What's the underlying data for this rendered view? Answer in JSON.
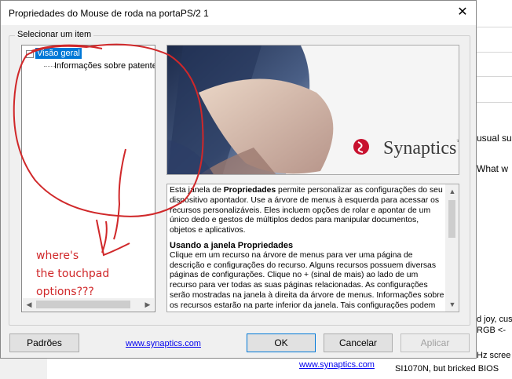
{
  "dialog": {
    "title": "Propriedades do Mouse de roda na portaPS/2  1",
    "close_glyph": "✕",
    "group_label": "Selecionar um item"
  },
  "tree": {
    "expander_glyph": "−",
    "root": "Visão geral",
    "child": "Informações sobre patentes"
  },
  "logo": {
    "text": "Synaptics",
    "tm": "™",
    "accent_color": "#c8102e"
  },
  "description": {
    "p1_pre": "Esta janela de ",
    "p1_bold": "Propriedades",
    "p1_post": " permite personalizar as configurações do seu dispositivo apontador. Use a árvore de menus à esquerda para acessar os recursos personalizáveis. Eles incluem opções de rolar e apontar de um único dedo e gestos de múltiplos dedos para manipular documentos, objetos e aplicativos.",
    "heading": "Usando a janela Propriedades",
    "p2": "Clique em um recurso na árvore de menus para ver uma página de descrição e configurações do recurso. Alguns recursos possuem diversas páginas de configurações. Clique no + (sinal de mais) ao lado de um recurso para ver todas as suas páginas relacionadas. As configurações serão mostradas na janela à direita da árvore de menus. Informações sobre os recursos estarão na parte inferior da janela. Tais configurações podem"
  },
  "buttons": {
    "defaults": "Padrões",
    "link": "www.synaptics.com",
    "ok": "OK",
    "cancel": "Cancelar",
    "apply": "Aplicar"
  },
  "background": {
    "frag1": "usual su",
    "frag2": "What w",
    "frag3": "d joy, cus",
    "frag4": "RGB <-",
    "frag5": "Hz scree",
    "frag6": "SI1070N, but bricked BIOS",
    "link": "www.synaptics.com"
  },
  "annotation": {
    "line1": "where's",
    "line2": "the touchpad",
    "line3": "options???",
    "color": "#d0282a"
  }
}
